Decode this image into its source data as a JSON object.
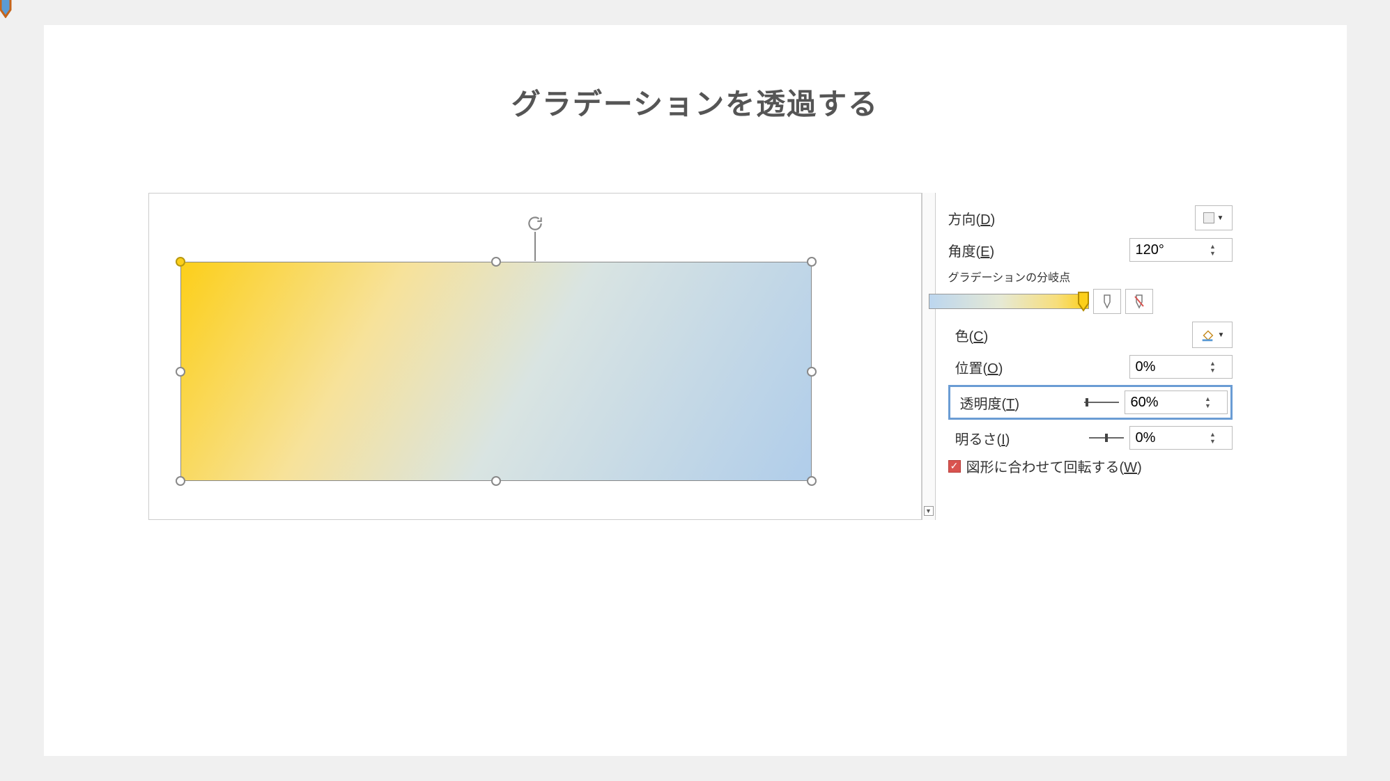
{
  "title": "グラデーションを透過する",
  "panel": {
    "direction": {
      "label": "方向(",
      "key": "D",
      "suffix": ")"
    },
    "angle": {
      "label": "角度(",
      "key": "E",
      "suffix": ")",
      "value": "120°"
    },
    "stopsLabel": "グラデーションの分岐点",
    "color": {
      "label": "色(",
      "key": "C",
      "suffix": ")"
    },
    "position": {
      "label": "位置(",
      "key": "O",
      "suffix": ")",
      "value": "0%"
    },
    "transparency": {
      "label": "透明度(",
      "key": "T",
      "suffix": ")",
      "value": "60%"
    },
    "brightness": {
      "label": "明るさ(",
      "key": "I",
      "suffix": ")",
      "value": "0%"
    },
    "rotateWithShape": {
      "label": "図形に合わせて回転する(",
      "key": "W",
      "suffix": ")",
      "checked": true
    }
  }
}
